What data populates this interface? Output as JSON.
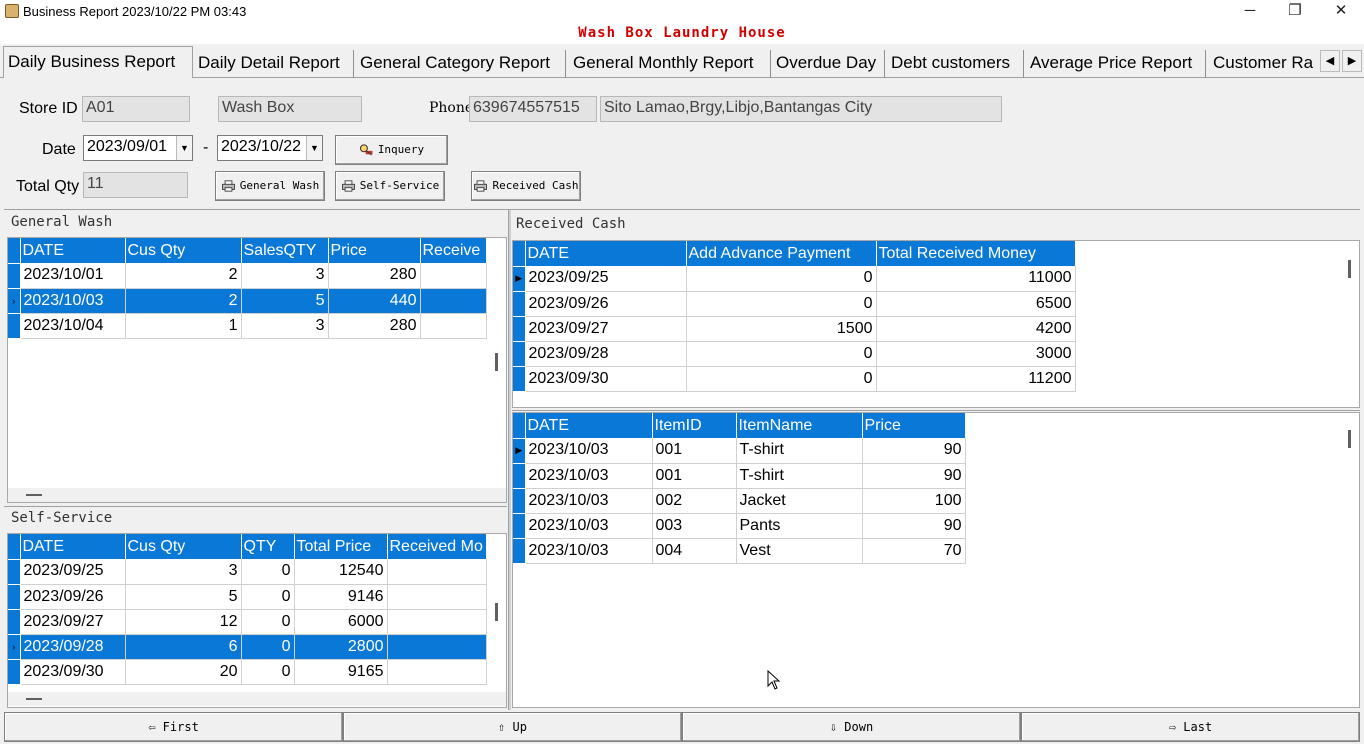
{
  "window": {
    "title": "Business Report   2023/10/22 PM 03:43",
    "minimize_glyph": "─",
    "restore_glyph": "❐",
    "close_glyph": "✕"
  },
  "company_name": "Wash Box Laundry House",
  "tabs": [
    {
      "label": "Daily Business Report"
    },
    {
      "label": "Daily Detail Report"
    },
    {
      "label": "General Category Report"
    },
    {
      "label": "General Monthly Report"
    },
    {
      "label": "Overdue Day"
    },
    {
      "label": "Debt customers"
    },
    {
      "label": "Average Price Report"
    },
    {
      "label": "Customer Ra"
    }
  ],
  "filters": {
    "store_id_label": "Store ID",
    "store_id": "A01",
    "store_name": "Wash Box",
    "phone_label": "Phone",
    "phone": "639674557515",
    "address": "Sito Lamao,Brgy,Libjo,Bantangas City",
    "date_label": "Date",
    "date_from": "2023/09/01",
    "date_sep": "-",
    "date_to": "2023/10/22",
    "total_qty_label": "Total Qty",
    "total_qty": "11"
  },
  "buttons": {
    "inquery": "Inquery",
    "general_wash": "General Wash",
    "self_service": "Self-Service",
    "received_cash": "Received Cash"
  },
  "general_wash": {
    "title": "General Wash",
    "columns": [
      "DATE",
      "Cus Qty",
      "SalesQTY",
      "Price",
      "Receive"
    ],
    "rows": [
      [
        "2023/10/01",
        "2",
        "3",
        "280",
        ""
      ],
      [
        "2023/10/03",
        "2",
        "5",
        "440",
        ""
      ],
      [
        "2023/10/04",
        "1",
        "3",
        "280",
        ""
      ]
    ],
    "selected_row": 1
  },
  "self_service": {
    "title": "Self-Service",
    "columns": [
      "DATE",
      "Cus Qty",
      "QTY",
      "Total Price",
      "Received Mo"
    ],
    "rows": [
      [
        "2023/09/25",
        "3",
        "0",
        "12540",
        ""
      ],
      [
        "2023/09/26",
        "5",
        "0",
        "9146",
        ""
      ],
      [
        "2023/09/27",
        "12",
        "0",
        "6000",
        ""
      ],
      [
        "2023/09/28",
        "6",
        "0",
        "2800",
        ""
      ],
      [
        "2023/09/30",
        "20",
        "0",
        "9165",
        ""
      ]
    ],
    "selected_row": 3
  },
  "received_cash": {
    "title": "Received Cash",
    "columns": [
      "DATE",
      "Add Advance Payment",
      "Total Received Money"
    ],
    "rows": [
      [
        "2023/09/25",
        "0",
        "11000"
      ],
      [
        "2023/09/26",
        "0",
        "6500"
      ],
      [
        "2023/09/27",
        "1500",
        "4200"
      ],
      [
        "2023/09/28",
        "0",
        "3000"
      ],
      [
        "2023/09/30",
        "0",
        "11200"
      ]
    ]
  },
  "items": {
    "columns": [
      "DATE",
      "ItemID",
      "ItemName",
      "Price"
    ],
    "rows": [
      [
        "2023/10/03",
        "001",
        "T-shirt",
        "90"
      ],
      [
        "2023/10/03",
        "001",
        "T-shirt",
        "90"
      ],
      [
        "2023/10/03",
        "002",
        "Jacket",
        "100"
      ],
      [
        "2023/10/03",
        "003",
        "Pants",
        "90"
      ],
      [
        "2023/10/03",
        "004",
        "Vest",
        "70"
      ]
    ]
  },
  "nav": {
    "first": "First",
    "up": "Up",
    "down": "Down",
    "last": "Last"
  },
  "icons": {
    "tab_prev": "◀",
    "tab_next": "▶",
    "dropdown": "▼",
    "row_pointer": "▶",
    "selected_row_pointer": "›",
    "nav_first": "⇦",
    "nav_up": "⇧",
    "nav_down": "⇩",
    "nav_last": "⇨"
  },
  "colors": {
    "grid_header": "#0a78d7",
    "company_title": "#d00000"
  }
}
